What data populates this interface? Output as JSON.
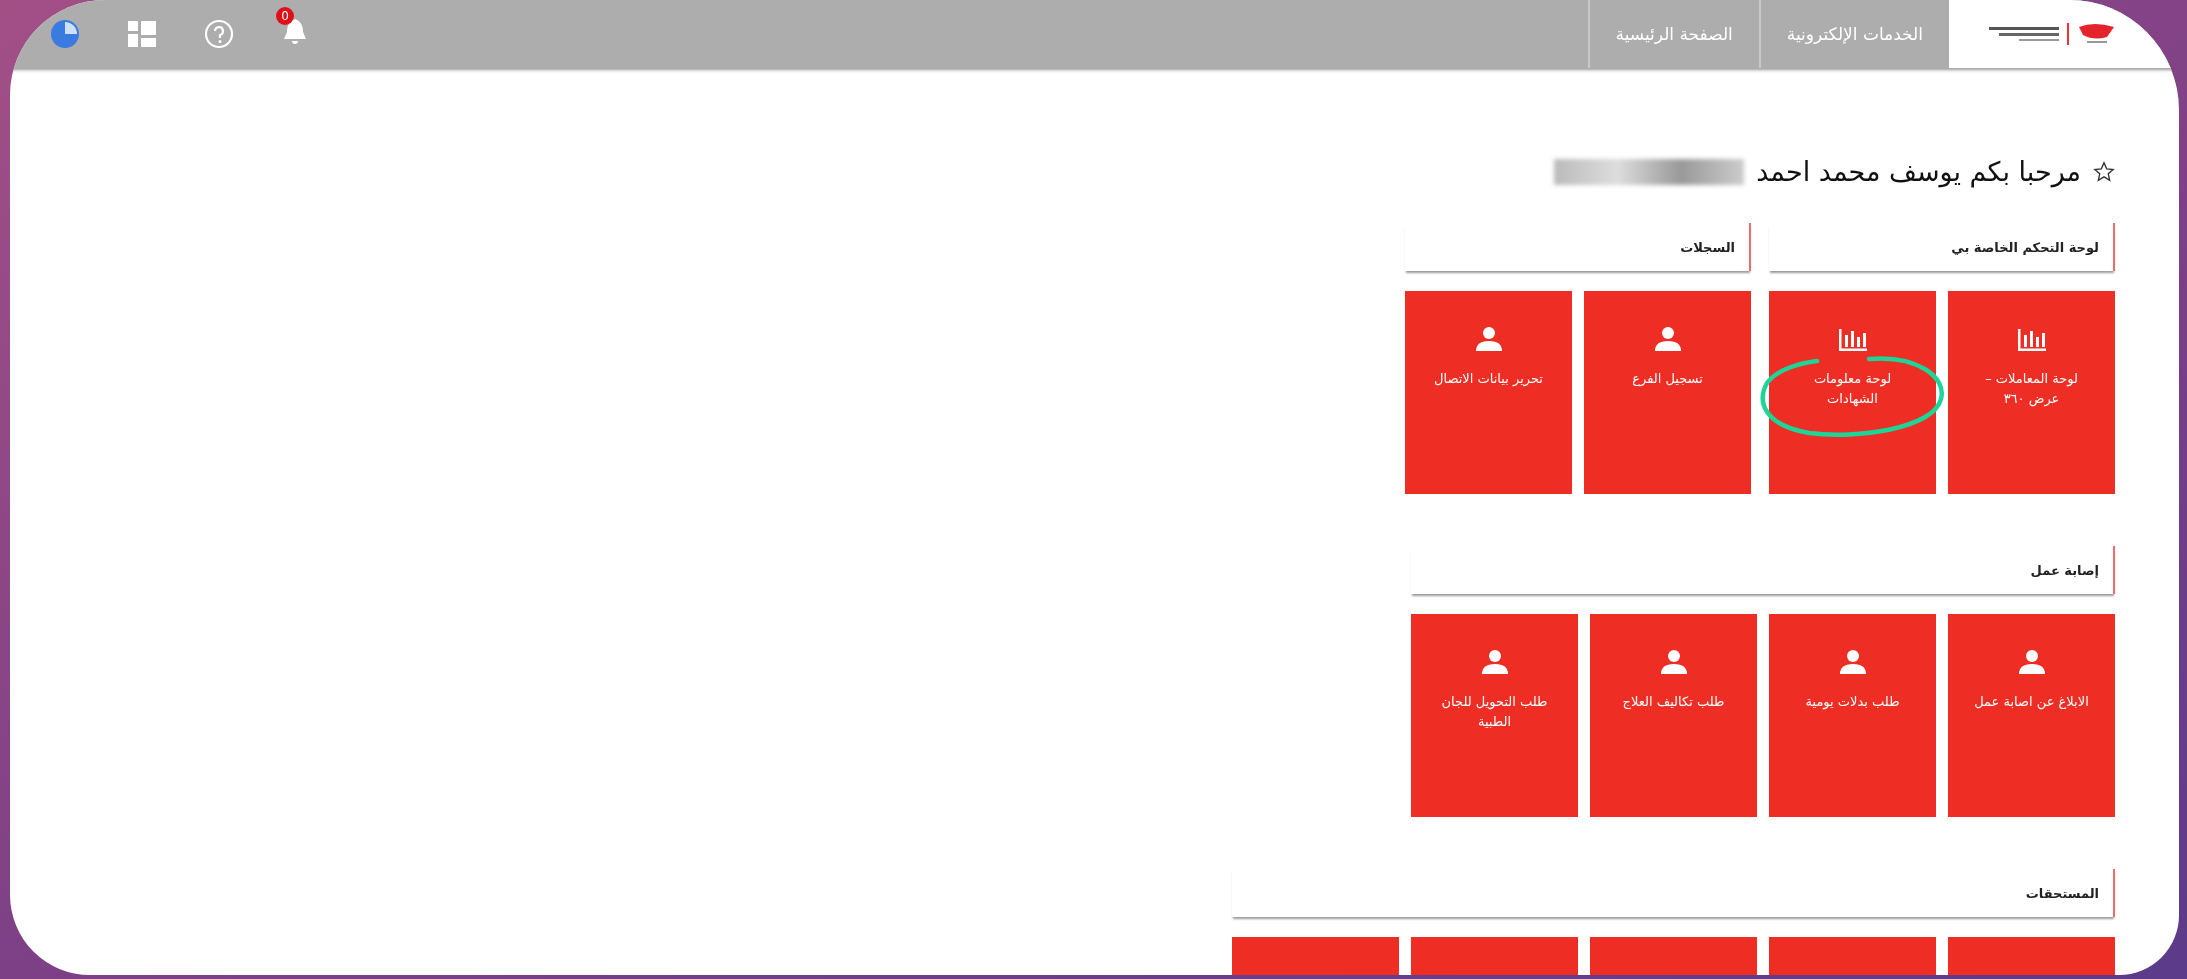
{
  "top_bar": {
    "nav_tabs": [
      {
        "label": "الخدمات الإلكترونية"
      },
      {
        "label": "الصفحة الرئيسية"
      }
    ],
    "notification_count": "0"
  },
  "welcome": {
    "text": "مرحبا بكم يوسف محمد احمد",
    "name_redacted": true
  },
  "rows": [
    {
      "sections": [
        {
          "title": "لوحة التحكم الخاصة بي",
          "tiles": [
            {
              "label": "لوحة المعاملات – عرض ٣٦٠",
              "kind": "chart",
              "circled": false
            },
            {
              "label": "لوحة معلومات الشهادات",
              "kind": "chart",
              "circled": true
            }
          ]
        },
        {
          "title": "السجلات",
          "tiles": [
            {
              "label": "تسجيل الفرع",
              "kind": "person",
              "circled": false
            },
            {
              "label": "تحرير بيانات الاتصال",
              "kind": "person",
              "circled": false
            }
          ]
        }
      ]
    },
    {
      "sections": [
        {
          "title": "إصابة عمل",
          "tiles": [
            {
              "label": "الابلاغ عن اصابة عمل",
              "kind": "person",
              "circled": false
            },
            {
              "label": "طلب بدلات يومية",
              "kind": "person",
              "circled": false
            },
            {
              "label": "طلب تكاليف العلاج",
              "kind": "person",
              "circled": false
            },
            {
              "label": "طلب التحويل للجان الطبية",
              "kind": "person",
              "circled": false
            }
          ]
        }
      ]
    },
    {
      "sections": [
        {
          "title": "المستحقات",
          "tiles": [
            {
              "kind": "cut"
            },
            {
              "kind": "cut"
            },
            {
              "kind": "cut"
            },
            {
              "kind": "cut"
            },
            {
              "kind": "cut"
            }
          ]
        }
      ]
    }
  ]
}
